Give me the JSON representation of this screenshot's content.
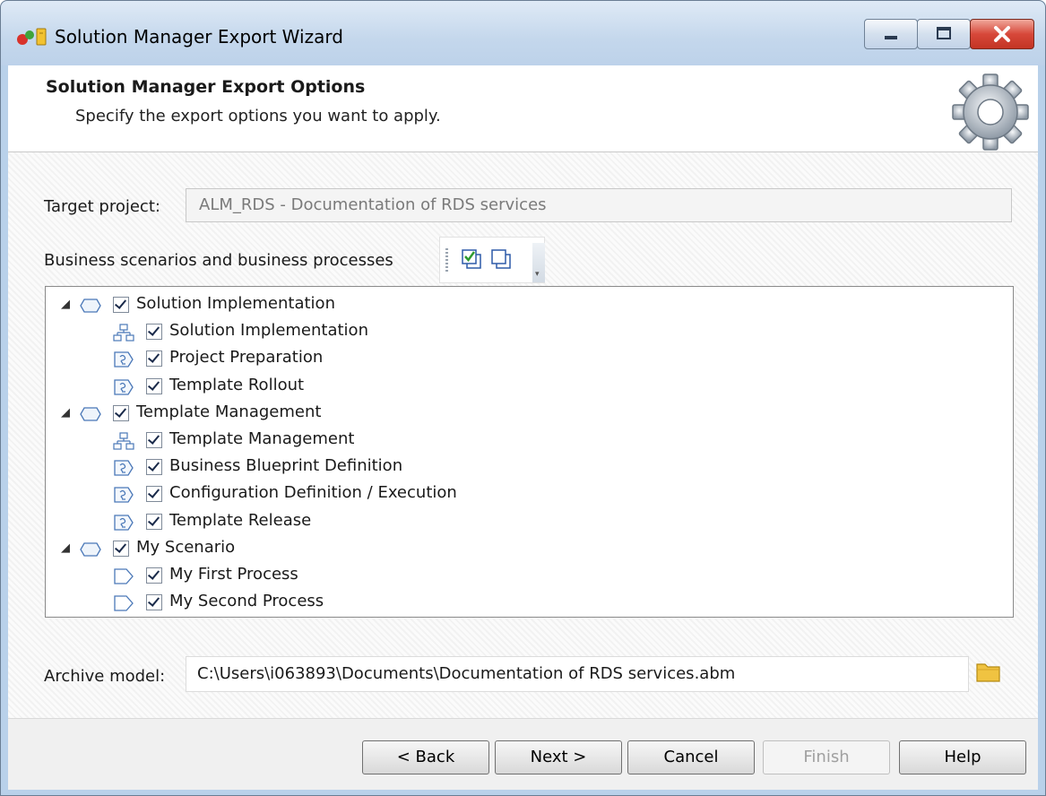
{
  "window": {
    "title": "Solution Manager Export Wizard"
  },
  "header": {
    "title": "Solution Manager Export Options",
    "subtitle": "Specify the export options you want to apply."
  },
  "target_project": {
    "label": "Target project:",
    "value": "ALM_RDS - Documentation of RDS services"
  },
  "tree_section": {
    "label": "Business scenarios and business processes",
    "toolbar": {
      "check_all_icon": "check-all-icon",
      "uncheck_all_icon": "uncheck-all-icon"
    },
    "nodes": [
      {
        "label": "Solution Implementation",
        "kind": "scenario",
        "level": 0,
        "checked": true,
        "expanded": true
      },
      {
        "label": "Solution Implementation",
        "kind": "process-structure",
        "level": 1,
        "checked": true
      },
      {
        "label": "Project Preparation",
        "kind": "process-step",
        "level": 1,
        "checked": true
      },
      {
        "label": "Template Rollout",
        "kind": "process-step",
        "level": 1,
        "checked": true
      },
      {
        "label": "Template Management",
        "kind": "scenario",
        "level": 0,
        "checked": true,
        "expanded": true
      },
      {
        "label": "Template Management",
        "kind": "process-structure",
        "level": 1,
        "checked": true
      },
      {
        "label": "Business Blueprint Definition",
        "kind": "process-step",
        "level": 1,
        "checked": true
      },
      {
        "label": "Configuration Definition / Execution",
        "kind": "process-step",
        "level": 1,
        "checked": true
      },
      {
        "label": "Template Release",
        "kind": "process-step",
        "level": 1,
        "checked": true
      },
      {
        "label": "My Scenario",
        "kind": "scenario",
        "level": 0,
        "checked": true,
        "expanded": true
      },
      {
        "label": "My First Process",
        "kind": "process",
        "level": 1,
        "checked": true
      },
      {
        "label": "My Second Process",
        "kind": "process",
        "level": 1,
        "checked": true
      }
    ]
  },
  "archive": {
    "label": "Archive model:",
    "value": "C:\\Users\\i063893\\Documents\\Documentation of RDS services.abm"
  },
  "buttons": {
    "back": "< Back",
    "next": "Next >",
    "cancel": "Cancel",
    "finish": "Finish",
    "help": "Help"
  }
}
